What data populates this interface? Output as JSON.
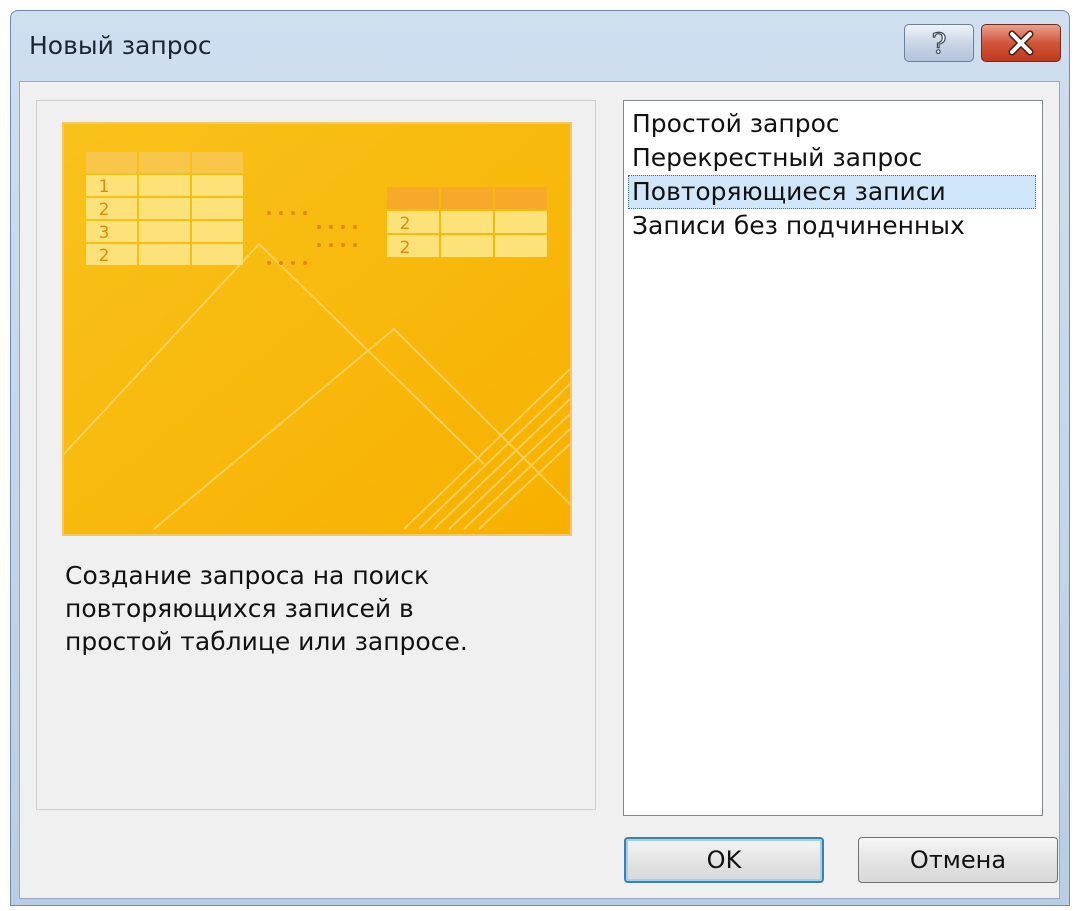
{
  "window": {
    "title": "Новый запрос",
    "help_label": "?",
    "close_icon": "close-icon",
    "close_color": "#c8452a"
  },
  "preview": {
    "left_table_rows": [
      "1",
      "2",
      "3",
      "2"
    ],
    "right_table_rows": [
      "2",
      "2"
    ],
    "accent_color": "#f7b80c"
  },
  "description": {
    "lines": [
      "Создание запроса на поиск",
      "повторяющихся записей в",
      "простой таблице или запросе."
    ]
  },
  "list": {
    "items": [
      {
        "label": "Простой запрос"
      },
      {
        "label": "Перекрестный запрос"
      },
      {
        "label": "Повторяющиеся записи",
        "selected": true
      },
      {
        "label": "Записи без подчиненных"
      }
    ]
  },
  "buttons": {
    "ok_label": "OK",
    "cancel_label": "Отмена"
  }
}
